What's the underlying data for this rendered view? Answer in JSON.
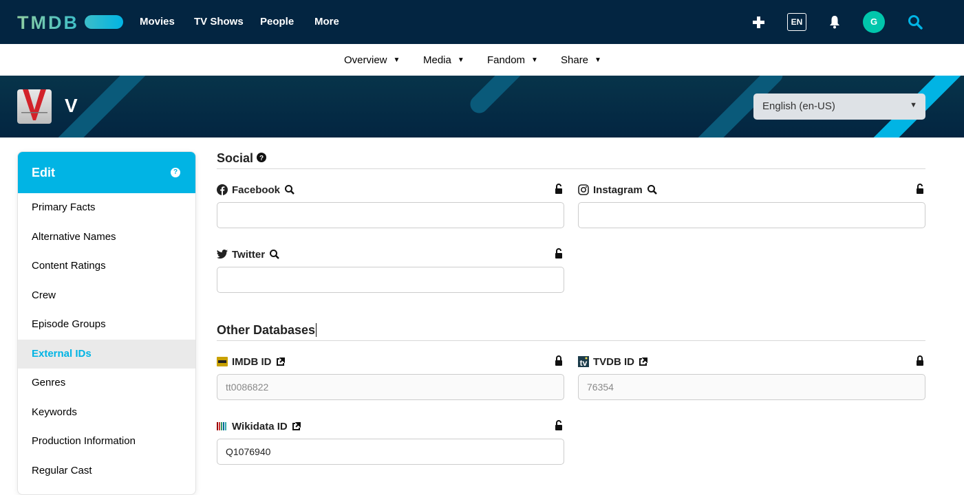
{
  "header": {
    "logo": "TMDB",
    "nav": [
      "Movies",
      "TV Shows",
      "People",
      "More"
    ],
    "lang_badge": "EN",
    "avatar_initial": "G",
    "accent": "#01b4e4",
    "background": "#032541"
  },
  "subnav": [
    "Overview",
    "Media",
    "Fandom",
    "Share"
  ],
  "banner": {
    "title": "V",
    "language": "English (en-US)"
  },
  "sidebar": {
    "title": "Edit",
    "items": [
      "Primary Facts",
      "Alternative Names",
      "Content Ratings",
      "Crew",
      "Episode Groups",
      "External IDs",
      "Genres",
      "Keywords",
      "Production Information",
      "Regular Cast"
    ],
    "active": "External IDs"
  },
  "social": {
    "title": "Social",
    "fields": [
      {
        "label": "Facebook",
        "value": "",
        "locked": false
      },
      {
        "label": "Instagram",
        "value": "",
        "locked": false
      },
      {
        "label": "Twitter",
        "value": "",
        "locked": false
      }
    ]
  },
  "databases": {
    "title": "Other Databases",
    "fields": [
      {
        "label": "IMDB ID",
        "value": "tt0086822",
        "locked": true
      },
      {
        "label": "TVDB ID",
        "value": "76354",
        "locked": true
      },
      {
        "label": "Wikidata ID",
        "value": "Q1076940",
        "locked": false
      }
    ]
  }
}
